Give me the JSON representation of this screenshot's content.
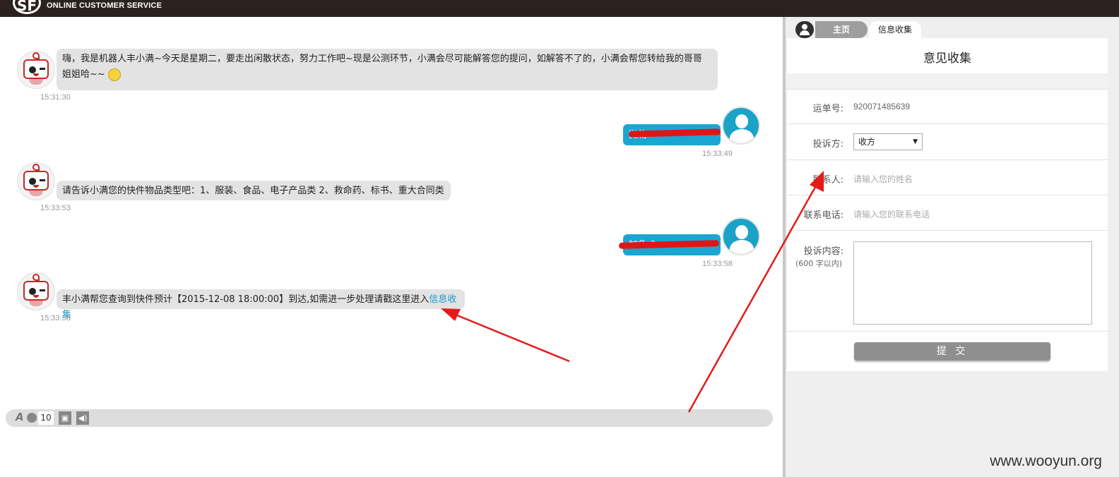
{
  "header": {
    "logo_text": "SF",
    "brand": "ONLINE CUSTOMER SERVICE"
  },
  "chat": {
    "messages": [
      {
        "from": "bot",
        "text": "嗨，我是机器人丰小满~今天是星期二，要走出闲散状态，努力工作吧~现是公测环节，小满会尽可能解答您的提问，如解答不了的，小满会帮您转给我的哥哥",
        "text2": "姐姐哈~~",
        "time": "15:31:30"
      },
      {
        "from": "user",
        "text": "抛物",
        "time": "15:33:49"
      },
      {
        "from": "bot",
        "text": "请告诉小满您的快件物品类型吧：1、服装、食品、电子产品类 2、救命药、标书、重大合同类",
        "time": "15:33:53"
      },
      {
        "from": "user",
        "text": "加急 9",
        "time": "15:33:58"
      },
      {
        "from": "bot",
        "text": "丰小满帮您查询到快件预计【2015-12-08 18:00:00】到达,如需进一步处理请戳这里进入",
        "link": "信息收集",
        "time": "15:33:58"
      }
    ]
  },
  "toolbar": {
    "font_icon_label": "A",
    "font_size": "10"
  },
  "tabs": {
    "home": "主页",
    "info": "信息收集"
  },
  "form": {
    "title": "意见收集",
    "waybill_label": "运单号:",
    "waybill_value": "920071485639",
    "party_label": "投诉方:",
    "party_value": "收方",
    "contact_label": "联系人:",
    "contact_placeholder": "请输入您的姓名",
    "phone_label": "联系电话:",
    "phone_placeholder": "请输入您的联系电话",
    "content_label": "投诉内容:",
    "content_note": "(600 字以内)",
    "submit": "提 交"
  },
  "watermark": "www.wooyun.org"
}
